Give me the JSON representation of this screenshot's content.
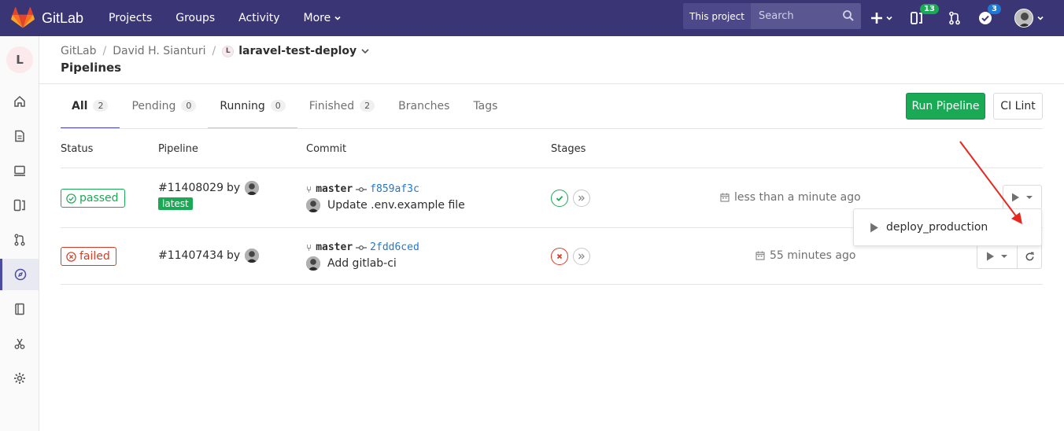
{
  "navbar": {
    "brand": "GitLab",
    "links": [
      "Projects",
      "Groups",
      "Activity",
      "More"
    ],
    "search_scope": "This project",
    "search_placeholder": "Search",
    "issues_count": "13",
    "todos_count": "3"
  },
  "sidebar": {
    "project_initial": "L"
  },
  "breadcrumb": {
    "root": "GitLab",
    "group": "David H. Sianturi",
    "project_initial": "L",
    "project": "laravel-test-deploy"
  },
  "page": {
    "title": "Pipelines"
  },
  "tabs": [
    {
      "label": "All",
      "count": "2"
    },
    {
      "label": "Pending",
      "count": "0"
    },
    {
      "label": "Running",
      "count": "0"
    },
    {
      "label": "Finished",
      "count": "2"
    },
    {
      "label": "Branches"
    },
    {
      "label": "Tags"
    }
  ],
  "buttons": {
    "run_pipeline": "Run Pipeline",
    "ci_lint": "CI Lint"
  },
  "table": {
    "headers": {
      "status": "Status",
      "pipeline": "Pipeline",
      "commit": "Commit",
      "stages": "Stages"
    },
    "rows": [
      {
        "status": "passed",
        "pipeline_id": "#11408029",
        "by": "by",
        "latest_label": "latest",
        "branch": "master",
        "sha": "f859af3c",
        "commit_title": "Update .env.example file",
        "time": "less than a minute ago"
      },
      {
        "status": "failed",
        "pipeline_id": "#11407434",
        "by": "by",
        "branch": "master",
        "sha": "2fdd6ced",
        "commit_title": "Add gitlab-ci",
        "time": "55 minutes ago"
      }
    ]
  },
  "manual_dropdown": {
    "item": "deploy_production"
  },
  "colors": {
    "navbar": "#3a3575",
    "success": "#1aaa55",
    "failed": "#db3b21",
    "link": "#1f78d1",
    "annotation_arrow": "#e8261e"
  }
}
